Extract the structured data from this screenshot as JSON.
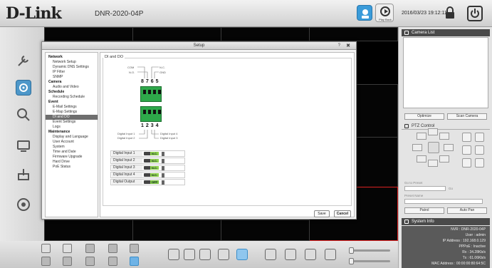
{
  "header": {
    "brand": "D-Link",
    "model": "DNR-2020-04P",
    "playback_label": "Play Back",
    "datetime": "2016/03/23 19:12:11"
  },
  "dialog": {
    "title": "Setup",
    "help_icon": "?",
    "close_icon": "✖",
    "section_title": "DI and DO",
    "nav": [
      {
        "label": "Network",
        "type": "category"
      },
      {
        "label": "Network Setup",
        "type": "item"
      },
      {
        "label": "Dynamic DNS Settings",
        "type": "item"
      },
      {
        "label": "IP Filter",
        "type": "item"
      },
      {
        "label": "SNMP",
        "type": "item"
      },
      {
        "label": "Camera",
        "type": "category"
      },
      {
        "label": "Audio and Video",
        "type": "item"
      },
      {
        "label": "Schedule",
        "type": "category"
      },
      {
        "label": "Recording Schedule",
        "type": "item"
      },
      {
        "label": "Event",
        "type": "category"
      },
      {
        "label": "E-Mail Settings",
        "type": "item"
      },
      {
        "label": "E-Map Settings",
        "type": "item"
      },
      {
        "label": "DI and DO",
        "type": "item",
        "selected": true
      },
      {
        "label": "Event Settings",
        "type": "item"
      },
      {
        "label": "Logs",
        "type": "item"
      },
      {
        "label": "Maintenance",
        "type": "category"
      },
      {
        "label": "Display and Language",
        "type": "item"
      },
      {
        "label": "User Account",
        "type": "item"
      },
      {
        "label": "System",
        "type": "item"
      },
      {
        "label": "Time and Date",
        "type": "item"
      },
      {
        "label": "Firmware Upgrade",
        "type": "item"
      },
      {
        "label": "Hard Drive",
        "type": "item"
      },
      {
        "label": "PoE Status",
        "type": "item"
      }
    ],
    "diagram": {
      "top_labels": [
        "COM",
        "N.O.",
        "N.C.",
        "GND"
      ],
      "top_numbers": "8765",
      "bottom_numbers": "1234",
      "bottom_labels": [
        "Digital Input 1",
        "Digital Input 2",
        "Digital Input 4",
        "Digital Input 3"
      ]
    },
    "io_rows": [
      {
        "label": "Digital Input 1",
        "state": "N.C."
      },
      {
        "label": "Digital Input 2",
        "state": "N.C."
      },
      {
        "label": "Digital Input 3",
        "state": "N.C."
      },
      {
        "label": "Digital Input 4",
        "state": "N.C."
      },
      {
        "label": "Digital Output",
        "state": "OFF"
      }
    ],
    "save_label": "Save",
    "cancel_label": "Cancel"
  },
  "right_panel": {
    "camera_list_title": "Camera List",
    "optimize_label": "Optimize",
    "scan_camera_label": "Scan Camera",
    "ptz_title": "PTZ Control",
    "go_to_preset_label": "Go to Preset",
    "preset_name_label": "Preset Name",
    "go_label": "Go",
    "patrol_label": "Patrol",
    "auto_pan_label": "Auto Pan",
    "system_info_title": "System Info",
    "system_info": [
      "NVR : DNR-2020-04P",
      "User : admin",
      "IP Address : 192.168.0.129",
      "PPPoE : Inactive",
      "Rx : 34.28Kb/s",
      "Tx : 61.06Kb/s",
      "MAC Address : 00:00:00:80:64:5C"
    ]
  },
  "colors": {
    "terminal_green": "#2ea84a",
    "toggle_green": "#8fd04e",
    "active_cell_border": "#dd2222",
    "live_blue": "#3a9bd9"
  }
}
